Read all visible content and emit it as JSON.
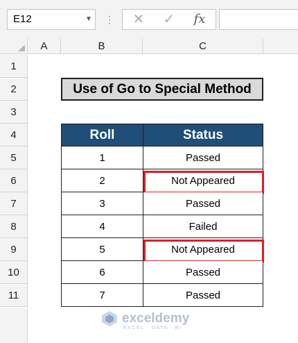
{
  "name_box": {
    "value": "E12"
  },
  "formula_bar": {
    "cancel_icon": "✕",
    "enter_icon": "✓",
    "fx_icon": "fx",
    "value": ""
  },
  "columns": [
    "A",
    "B",
    "C"
  ],
  "rows": [
    "1",
    "2",
    "3",
    "4",
    "5",
    "6",
    "7",
    "8",
    "9",
    "10",
    "11"
  ],
  "title": "Use of Go to Special Method",
  "table": {
    "headers": [
      "Roll",
      "Status"
    ],
    "rows": [
      {
        "roll": "1",
        "status": "Passed",
        "highlighted": false
      },
      {
        "roll": "2",
        "status": "Not Appeared",
        "highlighted": true
      },
      {
        "roll": "3",
        "status": "Passed",
        "highlighted": false
      },
      {
        "roll": "4",
        "status": "Failed",
        "highlighted": false
      },
      {
        "roll": "5",
        "status": "Not Appeared",
        "highlighted": true
      },
      {
        "roll": "6",
        "status": "Passed",
        "highlighted": false
      },
      {
        "roll": "7",
        "status": "Passed",
        "highlighted": false
      }
    ]
  },
  "watermark": {
    "name": "exceldemy",
    "tagline": "EXCEL · DATA · BI"
  },
  "colors": {
    "header_fill": "#1f4e79",
    "title_fill": "#d9d9d9",
    "highlight": "#e31b23"
  }
}
